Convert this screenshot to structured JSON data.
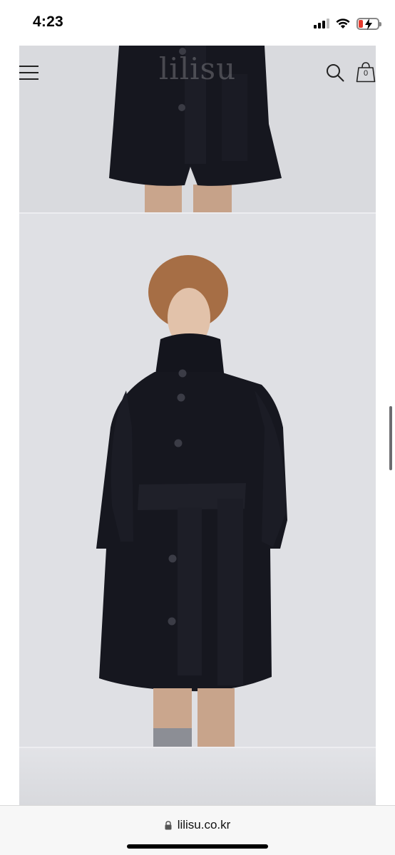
{
  "status_bar": {
    "time": "4:23",
    "icons": [
      "cellular-signal-icon",
      "wifi-icon",
      "battery-charging-icon"
    ],
    "battery_color": "#e63b2e"
  },
  "site_header": {
    "logo": "lilisu",
    "icons": [
      "hamburger-menu-icon",
      "search-icon",
      "shopping-bag-icon"
    ],
    "cart_count": "0"
  },
  "gallery": {
    "images": [
      "coat-detail-photo",
      "model-in-coat-photo",
      "next-product-photo"
    ],
    "coat_color": "#16171f"
  },
  "browser": {
    "url": "lilisu.co.kr",
    "lock_icon": "lock-icon"
  }
}
